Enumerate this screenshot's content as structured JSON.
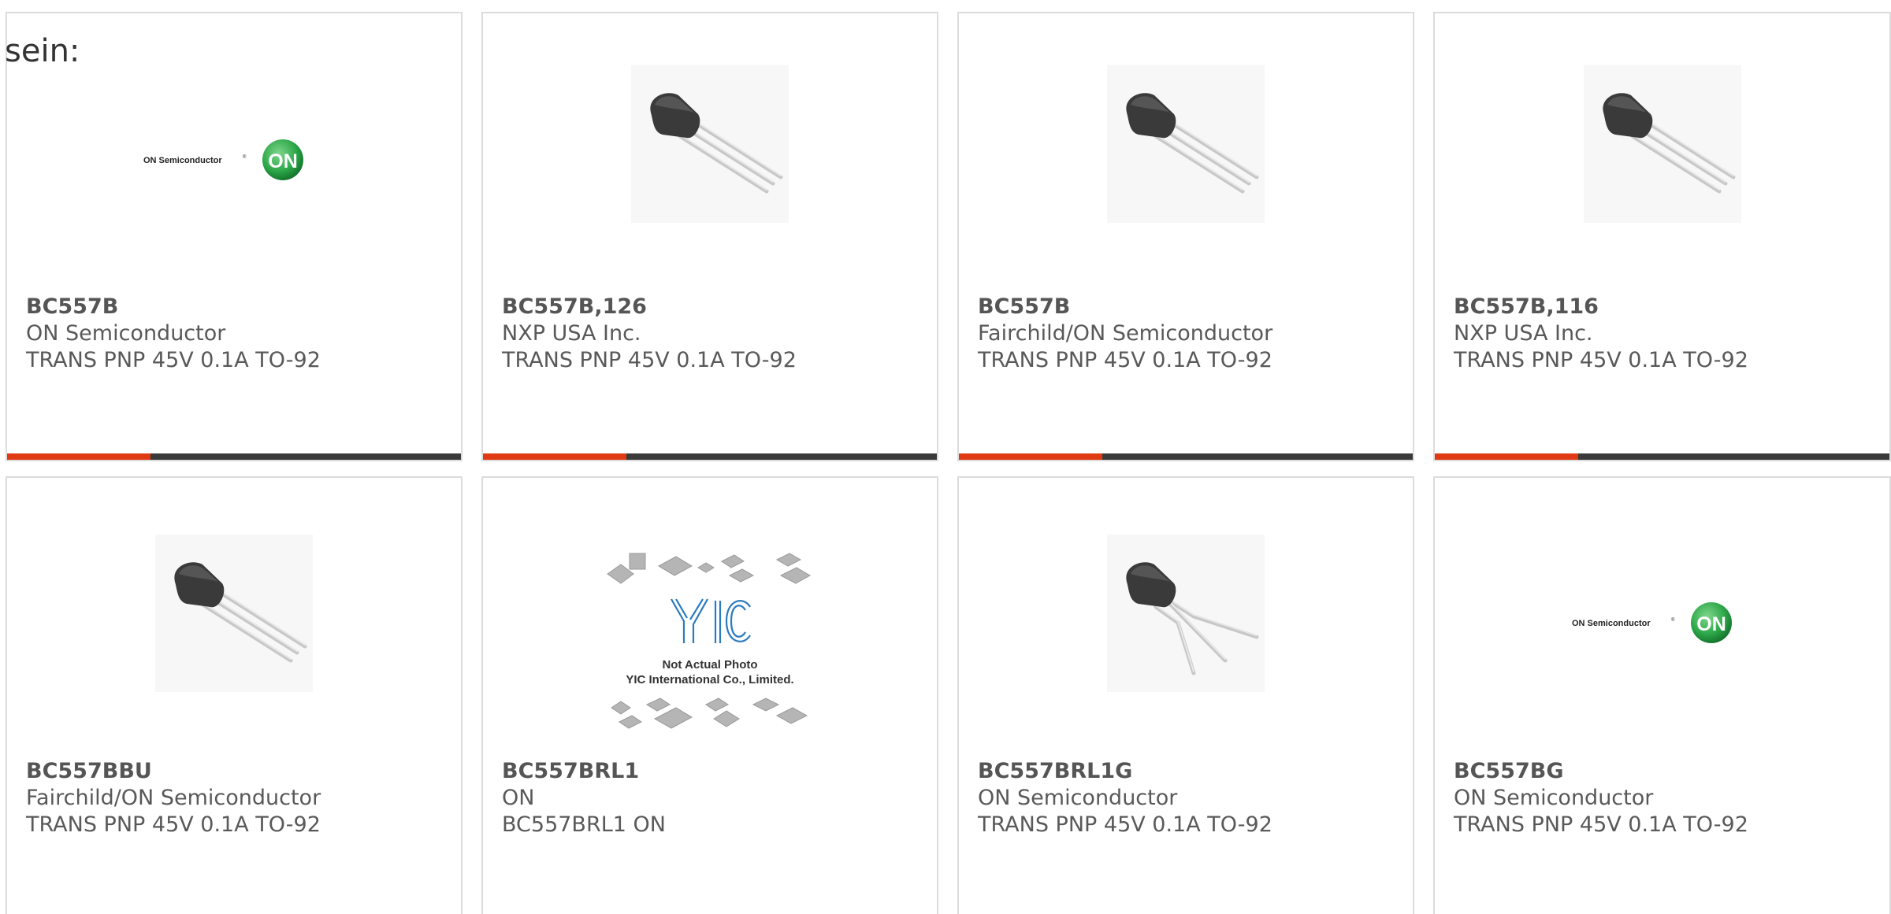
{
  "intro_text": "sein:",
  "colors": {
    "accent": "#e03a12",
    "bar": "#3a3a3a",
    "border": "#dcdcdc",
    "on_logo_green": "#2ea84a"
  },
  "products": [
    {
      "part": "BC557B",
      "manufacturer": "ON Semiconductor",
      "description": "TRANS PNP 45V 0.1A TO-92",
      "image": "on-semiconductor-logo"
    },
    {
      "part": "BC557B,126",
      "manufacturer": "NXP USA Inc.",
      "description": "TRANS PNP 45V 0.1A TO-92",
      "image": "transistor-to92-photo"
    },
    {
      "part": "BC557B",
      "manufacturer": "Fairchild/ON Semiconductor",
      "description": "TRANS PNP 45V 0.1A TO-92",
      "image": "transistor-to92-photo"
    },
    {
      "part": "BC557B,116",
      "manufacturer": "NXP USA Inc.",
      "description": "TRANS PNP 45V 0.1A TO-92",
      "image": "transistor-to92-photo"
    },
    {
      "part": "BC557BBU",
      "manufacturer": "Fairchild/ON Semiconductor",
      "description": "TRANS PNP 45V 0.1A TO-92",
      "image": "transistor-to92-photo"
    },
    {
      "part": "BC557BRL1",
      "manufacturer": "ON",
      "description": "BC557BRL1 ON",
      "image": "yic-placeholder",
      "placeholder_lines": [
        "Not Actual Photo",
        "YIC International Co., Limited."
      ],
      "placeholder_logo": "YIC"
    },
    {
      "part": "BC557BRL1G",
      "manufacturer": "ON Semiconductor",
      "description": "TRANS PNP 45V 0.1A TO-92",
      "image": "transistor-to92-bent-leads-photo"
    },
    {
      "part": "BC557BG",
      "manufacturer": "ON Semiconductor",
      "description": "TRANS PNP 45V 0.1A TO-92",
      "image": "on-semiconductor-logo"
    }
  ],
  "logo": {
    "wordmark": "ON Semiconductor",
    "registered": "®",
    "badge": "ON"
  }
}
